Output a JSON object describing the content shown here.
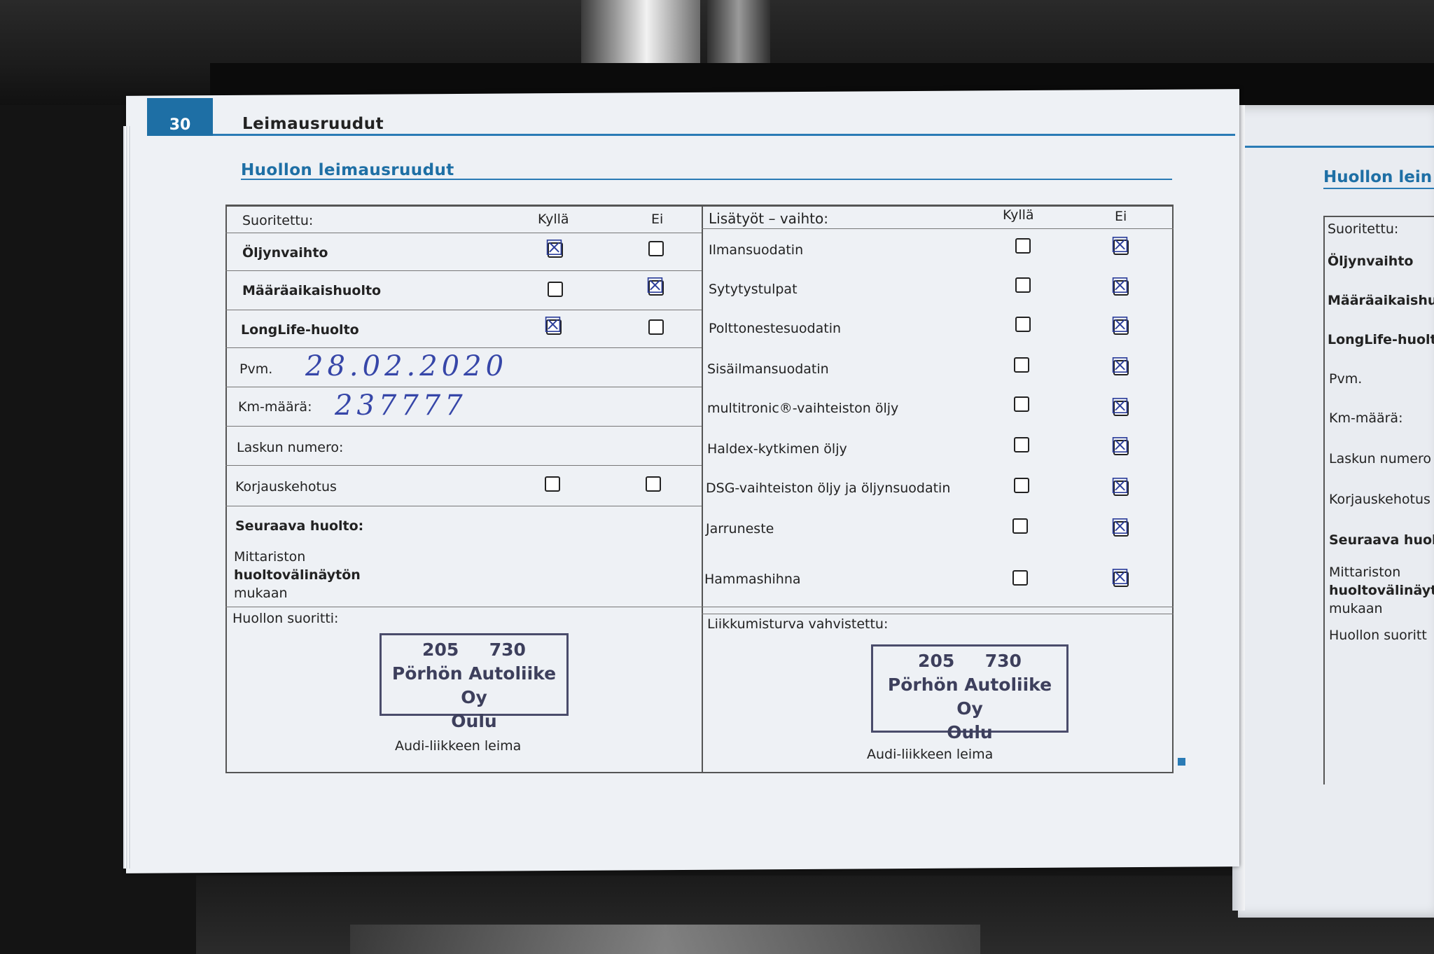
{
  "page": {
    "number": "30",
    "header": "Leimausruudut",
    "title": "Huollon leimausruudut"
  },
  "left_table": {
    "col_done": "Suoritettu:",
    "col_yes": "Kyllä",
    "col_no": "Ei",
    "rows": [
      {
        "label": "Öljynvaihto",
        "yes": true,
        "no": false
      },
      {
        "label": "Määräaikaishuolto",
        "yes": false,
        "no": true
      },
      {
        "label": "LongLife-huolto",
        "yes": true,
        "no": false
      }
    ],
    "date_label": "Pvm.",
    "date_value": "28.02.2020",
    "km_label": "Km-määrä:",
    "km_value": "237777",
    "invoice_label": "Laskun numero:",
    "repair_label": "Korjauskehotus",
    "next_label": "Seuraava huolto:",
    "meter_line1": "Mittariston",
    "meter_line2": "huoltovälinäytön",
    "meter_line3": "mukaan",
    "done_by": "Huollon suoritti:",
    "stamp": {
      "l1a": "205",
      "l1b": "730",
      "l2": "Pörhön Autoliike Oy",
      "l3": "Oulu"
    },
    "stamp_caption": "Audi-liikkeen leima"
  },
  "right_table": {
    "col_extra": "Lisätyöt – vaihto:",
    "col_yes": "Kyllä",
    "col_no": "Ei",
    "rows": [
      {
        "label": "Ilmansuodatin",
        "yes": false,
        "no": true
      },
      {
        "label": "Sytytystulpat",
        "yes": false,
        "no": true
      },
      {
        "label": "Polttonestesuodatin",
        "yes": false,
        "no": true
      },
      {
        "label": "Sisäilmansuodatin",
        "yes": false,
        "no": true
      },
      {
        "label": "multitronic®-vaihteiston öljy",
        "yes": false,
        "no": true
      },
      {
        "label": "Haldex-kytkimen öljy",
        "yes": false,
        "no": true
      },
      {
        "label": "DSG-vaihteiston öljy ja öljynsuodatin",
        "yes": false,
        "no": true
      },
      {
        "label": "Jarruneste",
        "yes": false,
        "no": true
      },
      {
        "label": "Hammashihna",
        "yes": false,
        "no": true
      }
    ],
    "confirmed": "Liikkumisturva vahvistettu:",
    "stamp": {
      "l1a": "205",
      "l1b": "730",
      "l2": "Pörhön Autoliike Oy",
      "l3": "Oulu"
    },
    "stamp_caption": "Audi-liikkeen leima"
  },
  "next_page": {
    "title": "Huollon lein",
    "rows": [
      "Suoritettu:",
      "Öljynvaihto",
      "Määräaikaishuolto",
      "LongLife-huolto",
      "Pvm.",
      "Km-määrä:",
      "Laskun numero",
      "Korjauskehotus",
      "Seuraava huolto",
      "Mittariston",
      "huoltovälinäytö",
      "mukaan",
      "Huollon suoritt"
    ]
  },
  "marks": {
    "check": "☒"
  }
}
